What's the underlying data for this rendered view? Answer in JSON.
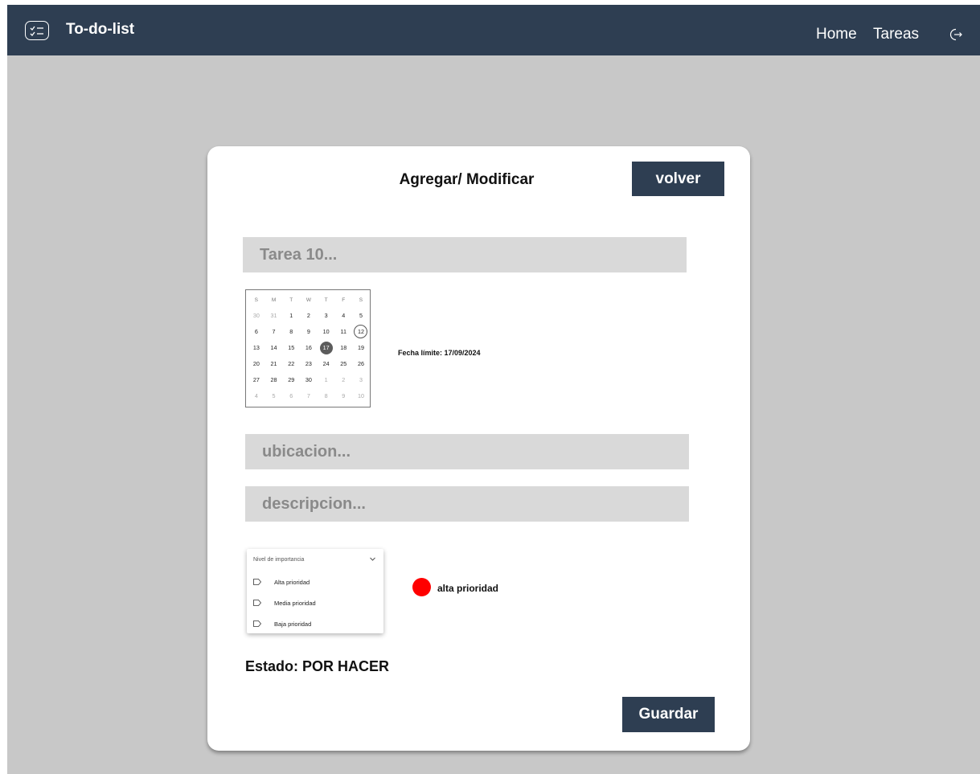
{
  "header": {
    "app_title": "To-do-list",
    "nav": {
      "home": "Home",
      "tareas": "Tareas"
    },
    "icons": {
      "app": "checklist-icon",
      "logout": "logout-icon"
    }
  },
  "form": {
    "title": "Agregar/ Modificar",
    "volver_label": "volver",
    "tarea_placeholder": "Tarea 10...",
    "ubicacion_placeholder": "ubicacion...",
    "descripcion_placeholder": "descripcion...",
    "fecha_limite": "Fecha límite: 17/09/2024",
    "importance": {
      "label": "Nivel de importancia",
      "options": [
        "Alta prioridad",
        "Media prioridad",
        "Baja prioridad"
      ]
    },
    "selected_priority_label": "alta prioridad",
    "priority_color": "#ff0000",
    "estado": "Estado: POR HACER",
    "guardar_label": "Guardar"
  },
  "calendar": {
    "weekdays": [
      "S",
      "M",
      "T",
      "W",
      "T",
      "F",
      "S"
    ],
    "weeks": [
      [
        "30",
        "31",
        "1",
        "2",
        "3",
        "4",
        "5"
      ],
      [
        "6",
        "7",
        "8",
        "9",
        "10",
        "11",
        "12"
      ],
      [
        "13",
        "14",
        "15",
        "16",
        "17",
        "18",
        "19"
      ],
      [
        "20",
        "21",
        "22",
        "23",
        "24",
        "25",
        "26"
      ],
      [
        "27",
        "28",
        "29",
        "30",
        "1",
        "2",
        "3"
      ],
      [
        "4",
        "5",
        "6",
        "7",
        "8",
        "9",
        "10"
      ]
    ],
    "today": "12",
    "selected": "17"
  },
  "colors": {
    "header_bg": "#2e3e52",
    "page_bg": "#c8c8c8",
    "field_bg": "#d9d9d9",
    "accent_red": "#ff0000"
  }
}
